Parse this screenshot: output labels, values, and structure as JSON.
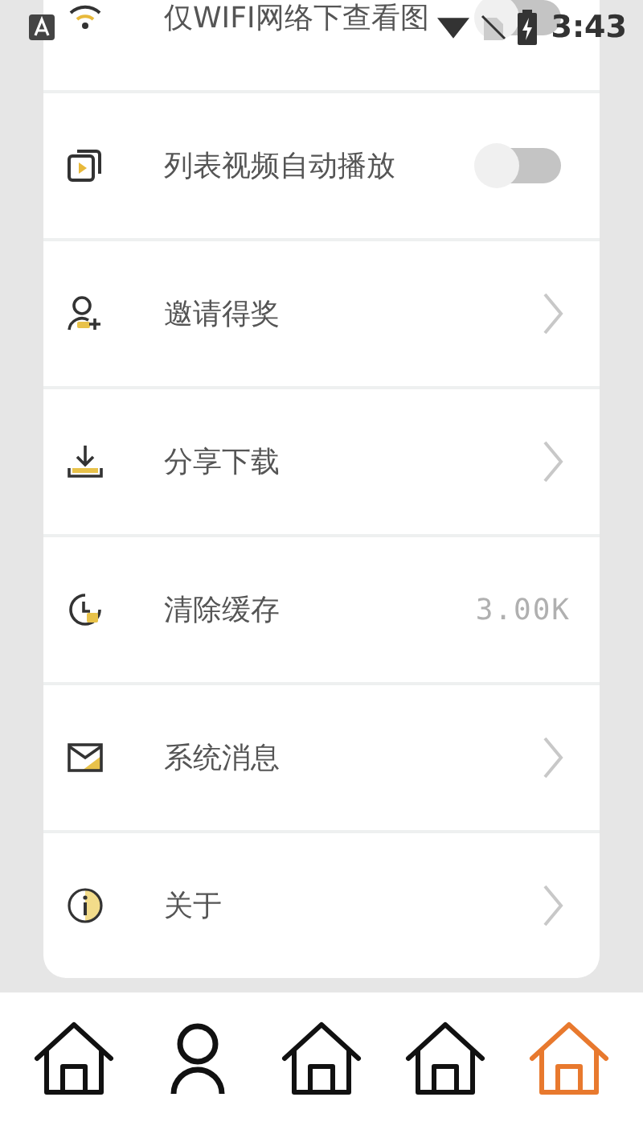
{
  "status_bar": {
    "time": "3:43"
  },
  "settings": [
    {
      "kind": "toggle",
      "label": "仅WIFI网络下查看图",
      "on": false
    },
    {
      "kind": "toggle",
      "label": "列表视频自动播放",
      "on": false
    },
    {
      "kind": "link",
      "label": "邀请得奖"
    },
    {
      "kind": "link",
      "label": "分享下载"
    },
    {
      "kind": "value",
      "label": "清除缓存",
      "value": "3.00K"
    },
    {
      "kind": "link",
      "label": "系统消息"
    },
    {
      "kind": "link",
      "label": "关于"
    }
  ],
  "tabs": [
    {
      "selected": false
    },
    {
      "selected": false
    },
    {
      "selected": false
    },
    {
      "selected": false
    },
    {
      "selected": true
    }
  ]
}
